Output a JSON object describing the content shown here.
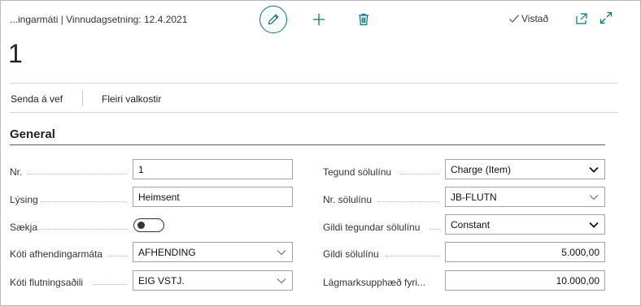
{
  "header": {
    "breadcrumb": "...ingarmáti | Vinnudagsetning: 12.4.2021",
    "saved_label": "Vistað",
    "page_title": "1"
  },
  "actions": {
    "send_label": "Senda á vef",
    "more_label": "Fleiri valkostir"
  },
  "section": {
    "title": "General"
  },
  "left_fields": {
    "nr": {
      "label": "Nr.",
      "value": "1"
    },
    "description": {
      "label": "Lýsing",
      "value": "Heimsent"
    },
    "fetch": {
      "label": "Sækja",
      "value": false
    },
    "shipping_code": {
      "label": "Kóti afhendingarmáta",
      "value": "AFHENDING"
    },
    "carrier_code": {
      "label": "Kóti flutningsaðili",
      "value": "EIG VSTJ."
    }
  },
  "right_fields": {
    "line_type": {
      "label": "Tegund sölulínu",
      "value": "Charge (Item)"
    },
    "line_no": {
      "label": "Nr. sölulínu",
      "value": "JB-FLUTN"
    },
    "line_type_value": {
      "label": "Gildi tegundar sölulínu",
      "value": "Constant"
    },
    "line_value": {
      "label": "Gildi sölulínu",
      "value": "5.000,00"
    },
    "min_amount": {
      "label": "Lágmarksupphæð fyri...",
      "value": "10.000,00"
    }
  },
  "colors": {
    "accent": "#00757a",
    "border": "#a3a3a3",
    "text": "#212121"
  },
  "icons": [
    "edit-icon",
    "plus-icon",
    "trash-icon",
    "checkmark-icon",
    "popout-icon",
    "expand-icon",
    "chevron-down-icon"
  ]
}
